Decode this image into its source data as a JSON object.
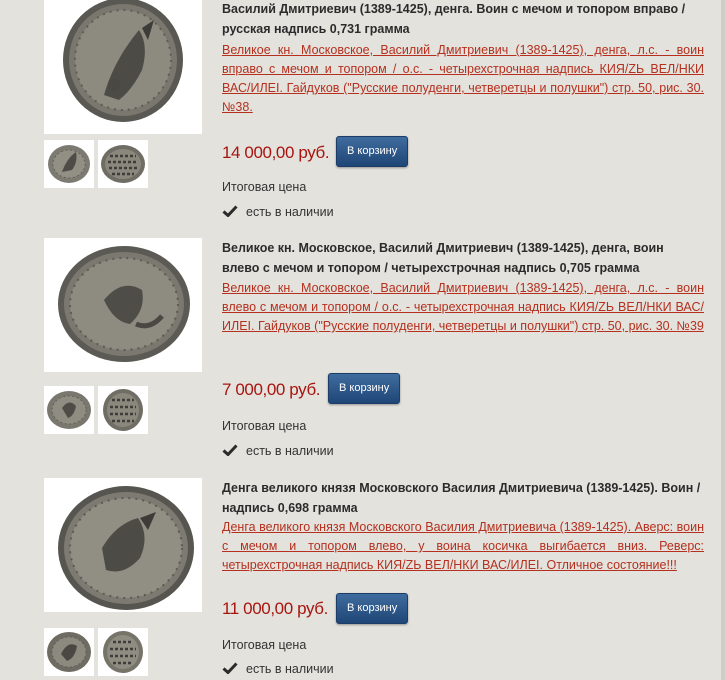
{
  "products": [
    {
      "title": "Василий Дмитриевич (1389-1425), денга. Воин с мечом и топором вправо / русская надпись 0,731 грамма",
      "description": "Великое кн. Московское, Василий Дмитриевич (1389-1425), денга, л.с. - воин вправо с мечом и топором / о.с. - четырехстрочная надпись КИЯ/ZЬ ВЕЛ/НКИ ВАС/ИЛЕI. Гайдуков (\"Русские полуденги, четверетцы и полушки\") стр. 50, рис. 30. №38.",
      "price": "14 000,00 руб.",
      "cart_label": "В корзину",
      "total_label": "Итоговая цена",
      "stock_label": "есть в наличии",
      "main_image_icon": "coin-warrior-right-image",
      "thumb_icons": [
        "coin-obverse-thumb",
        "coin-reverse-thumb"
      ]
    },
    {
      "title": "Великое кн. Московское, Василий Дмитриевич (1389-1425), денга, воин влево с мечом и топором / четырехстрочная надпись 0,705 грамма",
      "description": "Великое кн. Московское, Василий Дмитриевич (1389-1425), денга, л.с. - воин влево с мечом и топором / о.с. - четырехстрочная надпись КИЯ/ZЬ ВЕЛ/НКИ ВАС/ИЛЕI. Гайдуков (\"Русские полуденги, четверетцы и полушки\") стр. 50, рис. 30. №39",
      "price": "7 000,00 руб.",
      "cart_label": "В корзину",
      "total_label": "Итоговая цена",
      "stock_label": "есть в наличии",
      "main_image_icon": "coin-warrior-left-image",
      "thumb_icons": [
        "coin-obverse-thumb",
        "coin-reverse-thumb"
      ]
    },
    {
      "title": "Денга великого князя Московского Василия Дмитриевича (1389-1425). Воин / надпись 0,698 грамма",
      "description": "Денга великого князя Московского Василия Дмитриевича (1389-1425). Аверс: воин с мечом и топором влево, у воина косичка выгибается вниз. Реверс: четырехстрочная надпись КИЯ/ZЬ ВЕЛ/НКИ ВАС/ИЛЕI. Отличное состояние!!!",
      "price": "11 000,00 руб.",
      "cart_label": "В корзину",
      "total_label": "Итоговая цена",
      "stock_label": "есть в наличии",
      "main_image_icon": "coin-warrior-left-image",
      "thumb_icons": [
        "coin-obverse-thumb",
        "coin-reverse-thumb"
      ]
    }
  ],
  "colors": {
    "background": "#e4e2dd",
    "price": "#a8140f",
    "link": "#b5301e",
    "button": "#2a5585"
  }
}
